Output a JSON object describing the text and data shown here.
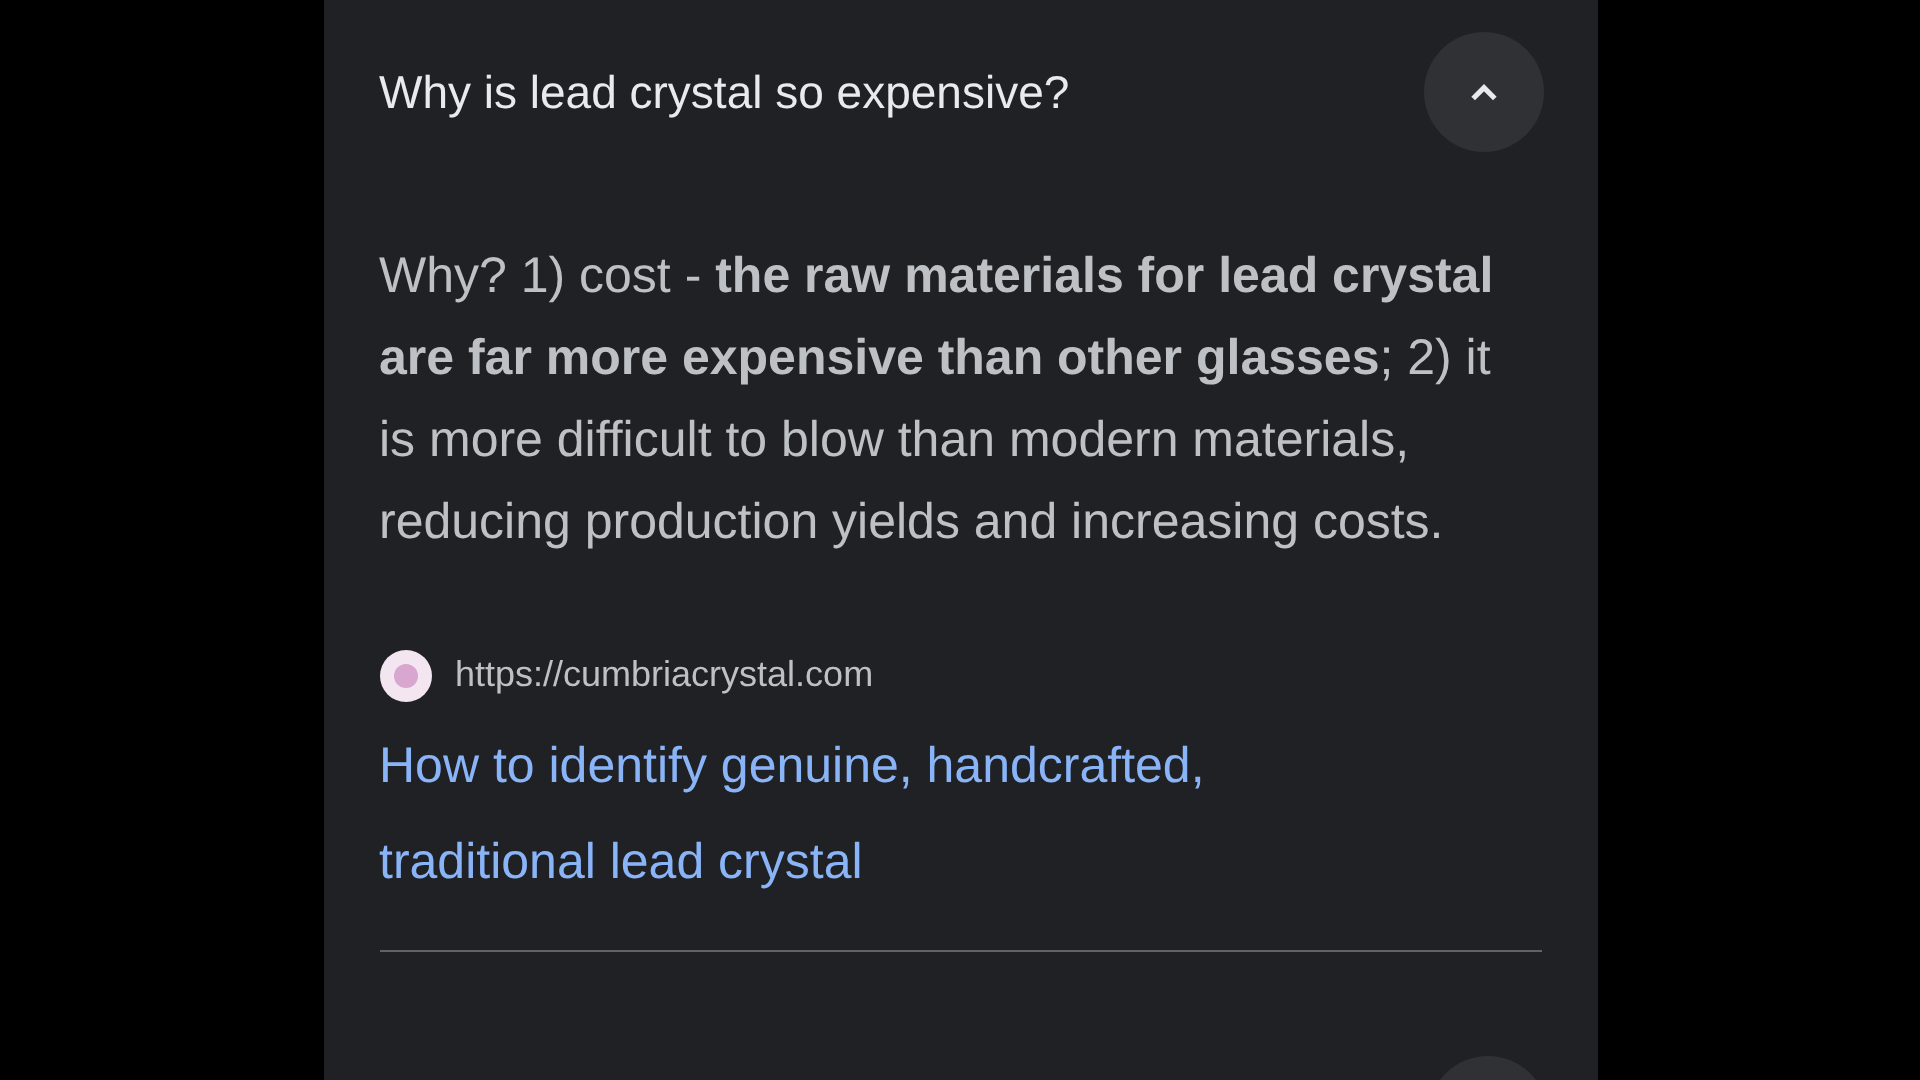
{
  "question": {
    "text": "Why is lead crystal so expensive?",
    "expanded": true
  },
  "answer": "Why? 1) cost - **the raw materials for lead crystal are far more expensive than other glasses**; 2) it is more difficult to blow than modern materials, reducing production yields and increasing costs.",
  "source": {
    "url": "https://cumbriacrystal.com",
    "title": "How to identify genuine, handcrafted, traditional lead crystal"
  }
}
